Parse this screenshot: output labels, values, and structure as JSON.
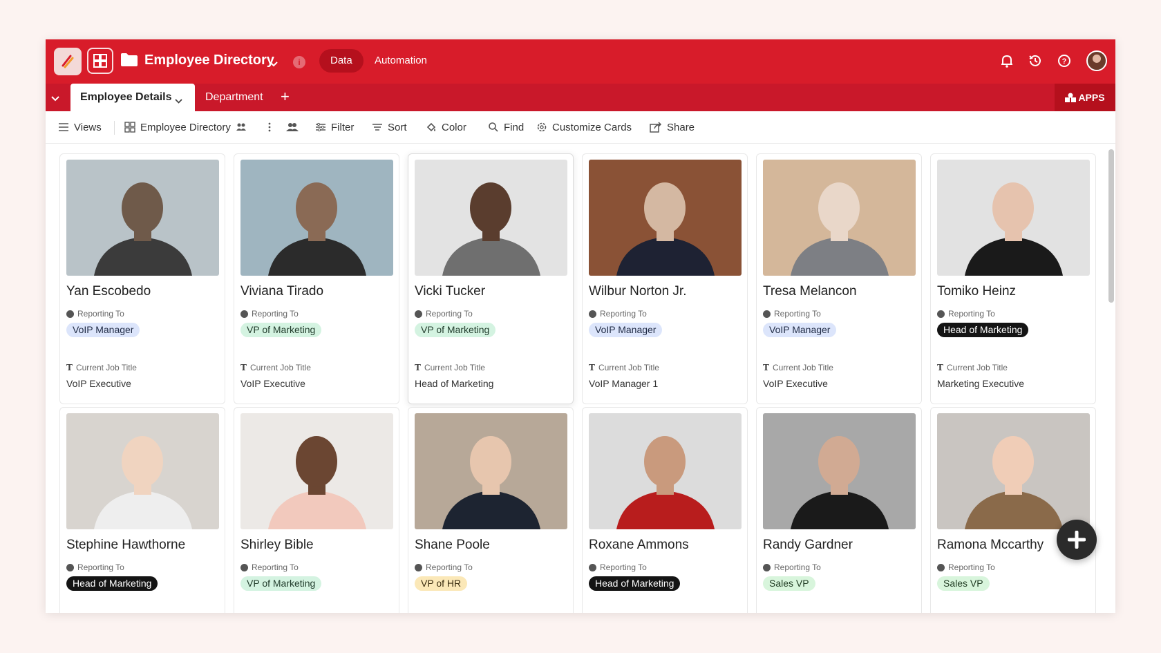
{
  "app": {
    "title": "Employee Directory",
    "nav_tabs": [
      "Data",
      "Automation"
    ],
    "active_nav": "Data",
    "brand_color": "#d81c2a"
  },
  "view_tabs": {
    "items": [
      {
        "label": "Employee Details",
        "active": true
      },
      {
        "label": "Department",
        "active": false
      }
    ],
    "apps_label": "APPS"
  },
  "toolbar": {
    "views_label": "Views",
    "view_name": "Employee Directory",
    "filter_label": "Filter",
    "sort_label": "Sort",
    "color_label": "Color",
    "find_label": "Find",
    "customize_label": "Customize Cards",
    "share_label": "Share"
  },
  "field_labels": {
    "reporting_to": "Reporting To",
    "job_title": "Current Job Title"
  },
  "employees": [
    {
      "name": "Yan Escobedo",
      "reporting_to": "VoIP Manager",
      "pill": "blue",
      "job_title": "VoIP Executive"
    },
    {
      "name": "Viviana Tirado",
      "reporting_to": "VP of Marketing",
      "pill": "green",
      "job_title": "VoIP Executive"
    },
    {
      "name": "Vicki Tucker",
      "reporting_to": "VP of Marketing",
      "pill": "green",
      "job_title": "Head of Marketing"
    },
    {
      "name": "Wilbur Norton Jr.",
      "reporting_to": "VoIP Manager",
      "pill": "blue",
      "job_title": "VoIP Manager 1"
    },
    {
      "name": "Tresa Melancon",
      "reporting_to": "VoIP Manager",
      "pill": "blue",
      "job_title": "VoIP Executive"
    },
    {
      "name": "Tomiko Heinz",
      "reporting_to": "Head of Marketing",
      "pill": "dark",
      "job_title": "Marketing Executive"
    },
    {
      "name": "Stephine Hawthorne",
      "reporting_to": "Head of Marketing",
      "pill": "dark",
      "job_title": ""
    },
    {
      "name": "Shirley Bible",
      "reporting_to": "VP of Marketing",
      "pill": "green",
      "job_title": ""
    },
    {
      "name": "Shane Poole",
      "reporting_to": "VP of HR",
      "pill": "yellow",
      "job_title": ""
    },
    {
      "name": "Roxane Ammons",
      "reporting_to": "Head of Marketing",
      "pill": "dark",
      "job_title": ""
    },
    {
      "name": "Randy Gardner",
      "reporting_to": "Sales VP",
      "pill": "lightgreen",
      "job_title": ""
    },
    {
      "name": "Ramona Mccarthy",
      "reporting_to": "Sales VP",
      "pill": "lightgreen",
      "job_title": ""
    }
  ],
  "pill_colors": {
    "blue": {
      "bg": "#dce5fb",
      "fg": "#1f2a44"
    },
    "green": {
      "bg": "#d4f3e1",
      "fg": "#1f3a2a"
    },
    "dark": {
      "bg": "#141414",
      "fg": "#ffffff"
    },
    "yellow": {
      "bg": "#fbe8b8",
      "fg": "#3a2c10"
    },
    "lightgreen": {
      "bg": "#d8f5dc",
      "fg": "#1f3a22"
    }
  },
  "photo_palettes": [
    [
      "#b9c3c8",
      "#6f5a4a",
      "#3b3b3b"
    ],
    [
      "#9fb5c0",
      "#8a6a55",
      "#2b2b2b"
    ],
    [
      "#e3e3e3",
      "#5a3d2e",
      "#6f6f6f"
    ],
    [
      "#8a5236",
      "#d4b8a2",
      "#1e2233"
    ],
    [
      "#d4b79a",
      "#e9d7c9",
      "#7d7f84"
    ],
    [
      "#e2e2e2",
      "#e6c3ae",
      "#1a1a1a"
    ],
    [
      "#d8d4cf",
      "#f0d4c0",
      "#eeeeee"
    ],
    [
      "#ece9e6",
      "#6b4632",
      "#f2c9bd"
    ],
    [
      "#b7a898",
      "#e7c6ae",
      "#1d2431"
    ],
    [
      "#dcdcdc",
      "#c99a7d",
      "#b81d1d"
    ],
    [
      "#a8a8a8",
      "#d1aa93",
      "#1a1a1a"
    ],
    [
      "#c9c5c1",
      "#f0cdb7",
      "#8a6a4a"
    ]
  ]
}
